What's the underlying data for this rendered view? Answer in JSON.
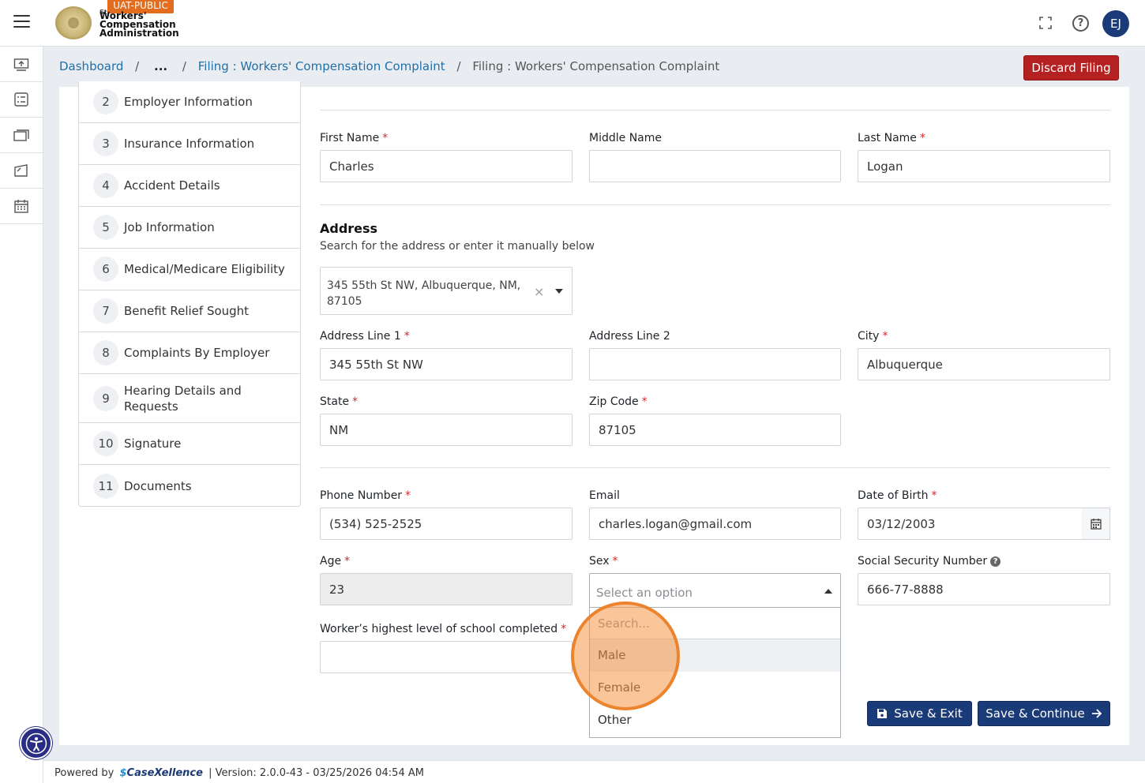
{
  "header": {
    "env_badge": "UAT-PUBLIC",
    "logo_small": "St",
    "logo_line1": "Workers'",
    "logo_line2": "Compensation",
    "logo_line3": "Administration",
    "help_glyph": "?",
    "avatar_initials": "EJ"
  },
  "rail": {
    "items": [
      "upload-icon",
      "checklist-icon",
      "briefcase-icon",
      "document-icon",
      "calendar-icon"
    ]
  },
  "breadcrumb": {
    "items": [
      "Dashboard",
      "...",
      "Filing : Workers' Compensation Complaint",
      "Filing : Workers' Compensation Complaint"
    ],
    "separator": "/"
  },
  "discard_label": "Discard Filing",
  "steps": [
    {
      "num": "2",
      "label": "Employer Information"
    },
    {
      "num": "3",
      "label": "Insurance Information"
    },
    {
      "num": "4",
      "label": "Accident Details"
    },
    {
      "num": "5",
      "label": "Job Information"
    },
    {
      "num": "6",
      "label": "Medical/Medicare Eligibility"
    },
    {
      "num": "7",
      "label": "Benefit Relief Sought"
    },
    {
      "num": "8",
      "label": "Complaints By Employer"
    },
    {
      "num": "9",
      "label": "Hearing Details and Requests"
    },
    {
      "num": "10",
      "label": "Signature"
    },
    {
      "num": "11",
      "label": "Documents"
    }
  ],
  "form": {
    "first_name": {
      "label": "First Name",
      "value": "Charles",
      "required": "*"
    },
    "middle_name": {
      "label": "Middle Name",
      "value": ""
    },
    "last_name": {
      "label": "Last Name",
      "value": "Logan",
      "required": "*"
    },
    "address_title": "Address",
    "address_subtitle": "Search for the address or enter it manually below",
    "address_search_value": "345 55th St NW, Albuquerque, NM, 87105",
    "address_clear": "×",
    "address1": {
      "label": "Address Line 1",
      "value": "345 55th St NW",
      "required": "*"
    },
    "address2": {
      "label": "Address Line 2",
      "value": ""
    },
    "city": {
      "label": "City",
      "value": "Albuquerque",
      "required": "*"
    },
    "state": {
      "label": "State",
      "value": "NM",
      "required": "*"
    },
    "zip": {
      "label": "Zip Code",
      "value": "87105",
      "required": "*"
    },
    "phone": {
      "label": "Phone Number",
      "value": "(534) 525-2525",
      "required": "*"
    },
    "email": {
      "label": "Email",
      "value": "charles.logan@gmail.com"
    },
    "dob": {
      "label": "Date of Birth",
      "value": "03/12/2003",
      "required": "*"
    },
    "age": {
      "label": "Age",
      "value": "23",
      "required": "*"
    },
    "sex": {
      "label": "Sex",
      "placeholder": "Select an option",
      "required": "*"
    },
    "ssn": {
      "label": "Social Security Number",
      "value": "666-77-8888",
      "info_glyph": "?"
    },
    "school": {
      "label": "Worker’s highest level of school completed",
      "value": "",
      "required": "*"
    }
  },
  "sex_dropdown": {
    "search_placeholder": "Search...",
    "options": [
      "Male",
      "Female",
      "Other"
    ],
    "hovered": "Male"
  },
  "buttons": {
    "save_exit": "Save & Exit",
    "save_continue": "Save & Continue"
  },
  "footer": {
    "powered_by": "Powered by",
    "brand_s": "$",
    "brand_name": "CaseXellence",
    "separator": "|",
    "version": "Version: 2.0.0-43 - 03/25/2026 04:54 AM"
  },
  "colors": {
    "primary": "#1b3a78",
    "danger": "#b52020",
    "link": "#1f6fa8",
    "badge": "#e36d1e",
    "highlight": "#f49646"
  }
}
